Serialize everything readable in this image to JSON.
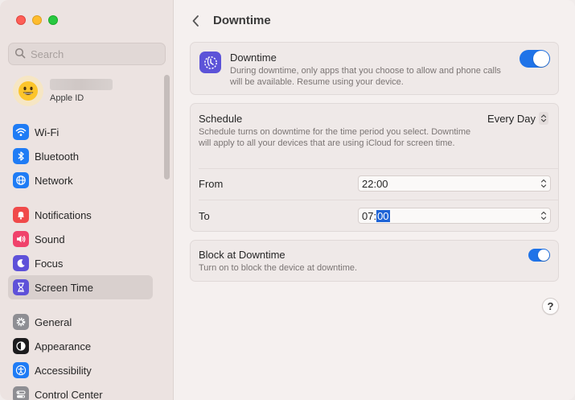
{
  "window": {
    "controls": [
      "close",
      "minimize",
      "zoom"
    ]
  },
  "sidebar": {
    "search": {
      "placeholder": "Search",
      "value": ""
    },
    "account": {
      "subtitle": "Apple ID"
    },
    "groups": [
      [
        {
          "label": "Wi-Fi",
          "icon": "wifi-icon",
          "color": "#1f7cf5"
        },
        {
          "label": "Bluetooth",
          "icon": "bluetooth-icon",
          "color": "#1f7cf5"
        },
        {
          "label": "Network",
          "icon": "globe-icon",
          "color": "#1f7cf5"
        }
      ],
      [
        {
          "label": "Notifications",
          "icon": "bell-icon",
          "color": "#f04a4a"
        },
        {
          "label": "Sound",
          "icon": "speaker-icon",
          "color": "#f0426b"
        },
        {
          "label": "Focus",
          "icon": "moon-icon",
          "color": "#5e51d9"
        },
        {
          "label": "Screen Time",
          "icon": "hourglass-icon",
          "color": "#5e51d9",
          "selected": true
        }
      ],
      [
        {
          "label": "General",
          "icon": "gear-icon",
          "color": "#8e8e93"
        },
        {
          "label": "Appearance",
          "icon": "appearance-icon",
          "color": "#1c1c1e"
        },
        {
          "label": "Accessibility",
          "icon": "accessibility-icon",
          "color": "#1f7cf5"
        },
        {
          "label": "Control Center",
          "icon": "control-center-icon",
          "color": "#8e8e93"
        }
      ]
    ]
  },
  "main": {
    "title": "Downtime",
    "downtime": {
      "title": "Downtime",
      "description": "During downtime, only apps that you choose to allow and phone calls will be available. Resume using your device.",
      "enabled": true
    },
    "schedule": {
      "title": "Schedule",
      "description": "Schedule turns on downtime for the time period you select. Downtime will apply to all your devices that are using iCloud for screen time.",
      "selected_option": "Every Day",
      "from_label": "From",
      "from_value": "22:00",
      "to_label": "To",
      "to_hours": "07:",
      "to_minutes": "00"
    },
    "block": {
      "title": "Block at Downtime",
      "description": "Turn on to block the device at downtime.",
      "enabled": true
    },
    "help_label": "?"
  },
  "colors": {
    "accent": "#1f73e8",
    "screen_time": "#5c53d8"
  }
}
